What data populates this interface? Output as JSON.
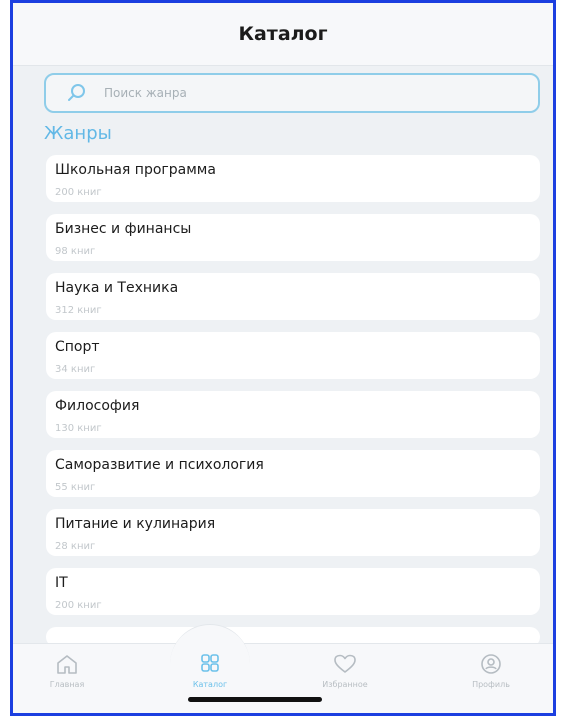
{
  "header": {
    "title": "Каталог"
  },
  "search": {
    "placeholder": "Поиск жанра"
  },
  "section_title": "Жанры",
  "genres": [
    {
      "name": "Школьная программа",
      "count": "200 книг"
    },
    {
      "name": "Бизнес и финансы",
      "count": "98 книг"
    },
    {
      "name": "Наука и Техника",
      "count": "312 книг"
    },
    {
      "name": "Спорт",
      "count": "34 книг"
    },
    {
      "name": "Философия",
      "count": "130 книг"
    },
    {
      "name": "Саморазвитие и психология",
      "count": "55 книг"
    },
    {
      "name": "Питание и кулинария",
      "count": "28 книг"
    },
    {
      "name": "IT",
      "count": "200 книг"
    }
  ],
  "tabs": [
    {
      "label": "Главная",
      "icon": "home-icon"
    },
    {
      "label": "Каталог",
      "icon": "catalog-grid-icon",
      "active": true
    },
    {
      "label": "Избранное",
      "icon": "heart-icon"
    },
    {
      "label": "Профиль",
      "icon": "profile-icon"
    }
  ],
  "colors": {
    "accent": "#62b8e6",
    "frame_border": "#1c3fe0"
  }
}
